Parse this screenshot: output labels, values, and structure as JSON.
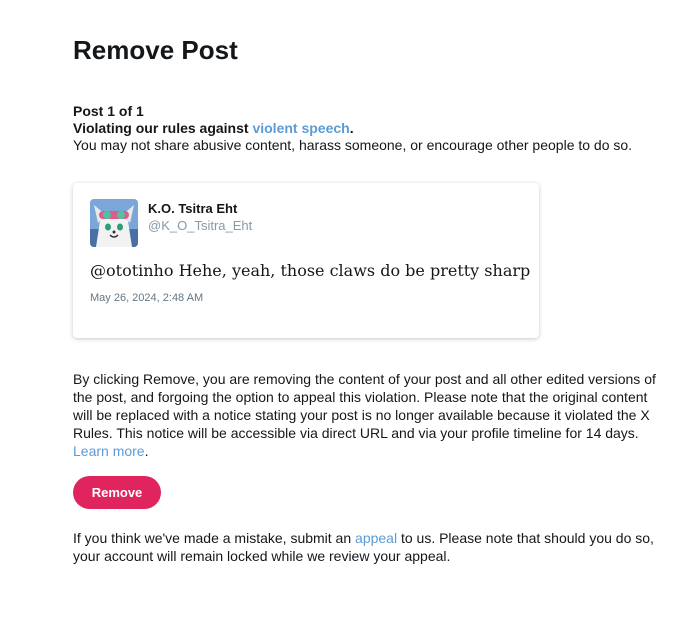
{
  "page": {
    "title": "Remove Post"
  },
  "violation": {
    "counter": "Post 1 of 1",
    "headline_prefix": "Violating our rules against ",
    "rule_link": "violent speech",
    "headline_suffix": ".",
    "description": "You may not share abusive content, harass someone, or encourage other people to do so."
  },
  "post": {
    "author_name": "K.O. Tsitra Eht",
    "author_handle": "@K_O_Tsitra_Eht",
    "text": "@ototinho Hehe, yeah, those claws do be pretty sharp",
    "timestamp": "May 26, 2024, 2:48 AM"
  },
  "explanation": {
    "text": "By clicking Remove, you are removing the content of your post and all other edited versions of the post, and forgoing the option to appeal this violation. Please note that the original content will be replaced with a notice stating your post is no longer available because it violated the X Rules. This notice will be accessible via direct URL and via your profile timeline for 14 days. ",
    "learn_more": "Learn more",
    "learn_more_suffix": "."
  },
  "actions": {
    "remove_label": "Remove"
  },
  "appeal": {
    "prefix": "If you think we've made a mistake, submit an ",
    "link": "appeal",
    "suffix": " to us. Please note that should you do so, your account will remain locked while we review your appeal."
  },
  "colors": {
    "link": "#5b9cd6",
    "remove_button": "#e0245e",
    "text": "#14171a",
    "muted": "#657786"
  }
}
